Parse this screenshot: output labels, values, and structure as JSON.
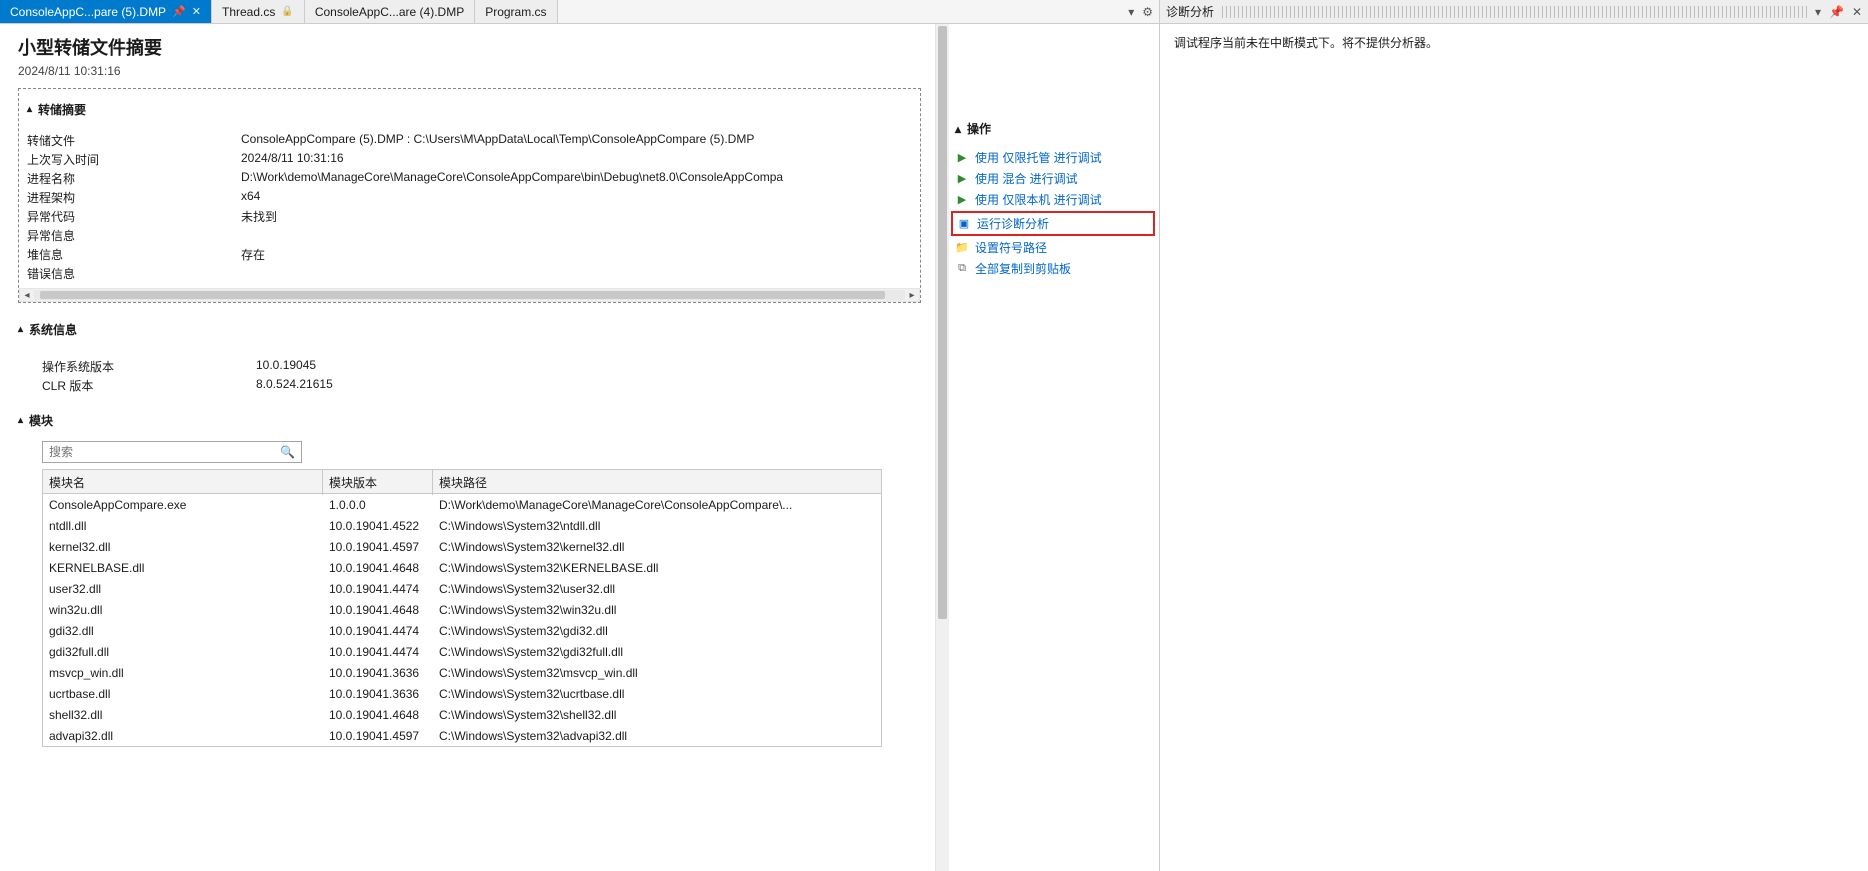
{
  "tabs": [
    {
      "label": "ConsoleAppC...pare (5).DMP",
      "active": true,
      "pinned": true,
      "closeable": true,
      "locked": false
    },
    {
      "label": "Thread.cs",
      "active": false,
      "pinned": false,
      "closeable": false,
      "locked": true
    },
    {
      "label": "ConsoleAppC...are (4).DMP",
      "active": false,
      "pinned": false,
      "closeable": false,
      "locked": false
    },
    {
      "label": "Program.cs",
      "active": false,
      "pinned": false,
      "closeable": false,
      "locked": false
    }
  ],
  "title": "小型转储文件摘要",
  "title_date": "2024/8/11 10:31:16",
  "sections": {
    "dump_summary": "转储摘要",
    "actions": "操作",
    "system_info": "系统信息",
    "modules": "模块"
  },
  "dump": {
    "labels": {
      "file": "转储文件",
      "last_write": "上次写入时间",
      "process_name": "进程名称",
      "arch": "进程架构",
      "exc_code": "异常代码",
      "exc_info": "异常信息",
      "stack": "堆信息",
      "err": "错误信息"
    },
    "values": {
      "file": "ConsoleAppCompare (5).DMP : C:\\Users\\M\\AppData\\Local\\Temp\\ConsoleAppCompare (5).DMP",
      "last_write": "2024/8/11 10:31:16",
      "process_name": "D:\\Work\\demo\\ManageCore\\ManageCore\\ConsoleAppCompare\\bin\\Debug\\net8.0\\ConsoleAppCompa",
      "arch": "x64",
      "exc_code": "未找到",
      "exc_info": "",
      "stack": "存在",
      "err": ""
    }
  },
  "actions": [
    {
      "icon": "play",
      "label": "使用 仅限托管 进行调试"
    },
    {
      "icon": "play",
      "label": "使用 混合 进行调试"
    },
    {
      "icon": "play",
      "label": "使用 仅限本机 进行调试"
    },
    {
      "icon": "diag",
      "label": "运行诊断分析",
      "highlight": true
    },
    {
      "icon": "box",
      "label": "设置符号路径"
    },
    {
      "icon": "copy",
      "label": "全部复制到剪贴板"
    }
  ],
  "sysinfo": {
    "labels": {
      "os": "操作系统版本",
      "clr": "CLR 版本"
    },
    "values": {
      "os": "10.0.19045",
      "clr": "8.0.524.21615"
    }
  },
  "search": {
    "placeholder": "搜索"
  },
  "modules": {
    "columns": {
      "name": "模块名",
      "version": "模块版本",
      "path": "模块路径"
    },
    "rows": [
      {
        "name": "ConsoleAppCompare.exe",
        "version": "1.0.0.0",
        "path": "D:\\Work\\demo\\ManageCore\\ManageCore\\ConsoleAppCompare\\..."
      },
      {
        "name": "ntdll.dll",
        "version": "10.0.19041.4522",
        "path": "C:\\Windows\\System32\\ntdll.dll"
      },
      {
        "name": "kernel32.dll",
        "version": "10.0.19041.4597",
        "path": "C:\\Windows\\System32\\kernel32.dll"
      },
      {
        "name": "KERNELBASE.dll",
        "version": "10.0.19041.4648",
        "path": "C:\\Windows\\System32\\KERNELBASE.dll"
      },
      {
        "name": "user32.dll",
        "version": "10.0.19041.4474",
        "path": "C:\\Windows\\System32\\user32.dll"
      },
      {
        "name": "win32u.dll",
        "version": "10.0.19041.4648",
        "path": "C:\\Windows\\System32\\win32u.dll"
      },
      {
        "name": "gdi32.dll",
        "version": "10.0.19041.4474",
        "path": "C:\\Windows\\System32\\gdi32.dll"
      },
      {
        "name": "gdi32full.dll",
        "version": "10.0.19041.4474",
        "path": "C:\\Windows\\System32\\gdi32full.dll"
      },
      {
        "name": "msvcp_win.dll",
        "version": "10.0.19041.3636",
        "path": "C:\\Windows\\System32\\msvcp_win.dll"
      },
      {
        "name": "ucrtbase.dll",
        "version": "10.0.19041.3636",
        "path": "C:\\Windows\\System32\\ucrtbase.dll"
      },
      {
        "name": "shell32.dll",
        "version": "10.0.19041.4648",
        "path": "C:\\Windows\\System32\\shell32.dll"
      },
      {
        "name": "advapi32.dll",
        "version": "10.0.19041.4597",
        "path": "C:\\Windows\\System32\\advapi32.dll"
      }
    ]
  },
  "panel": {
    "title": "诊断分析",
    "message": "调试程序当前未在中断模式下。将不提供分析器。"
  }
}
